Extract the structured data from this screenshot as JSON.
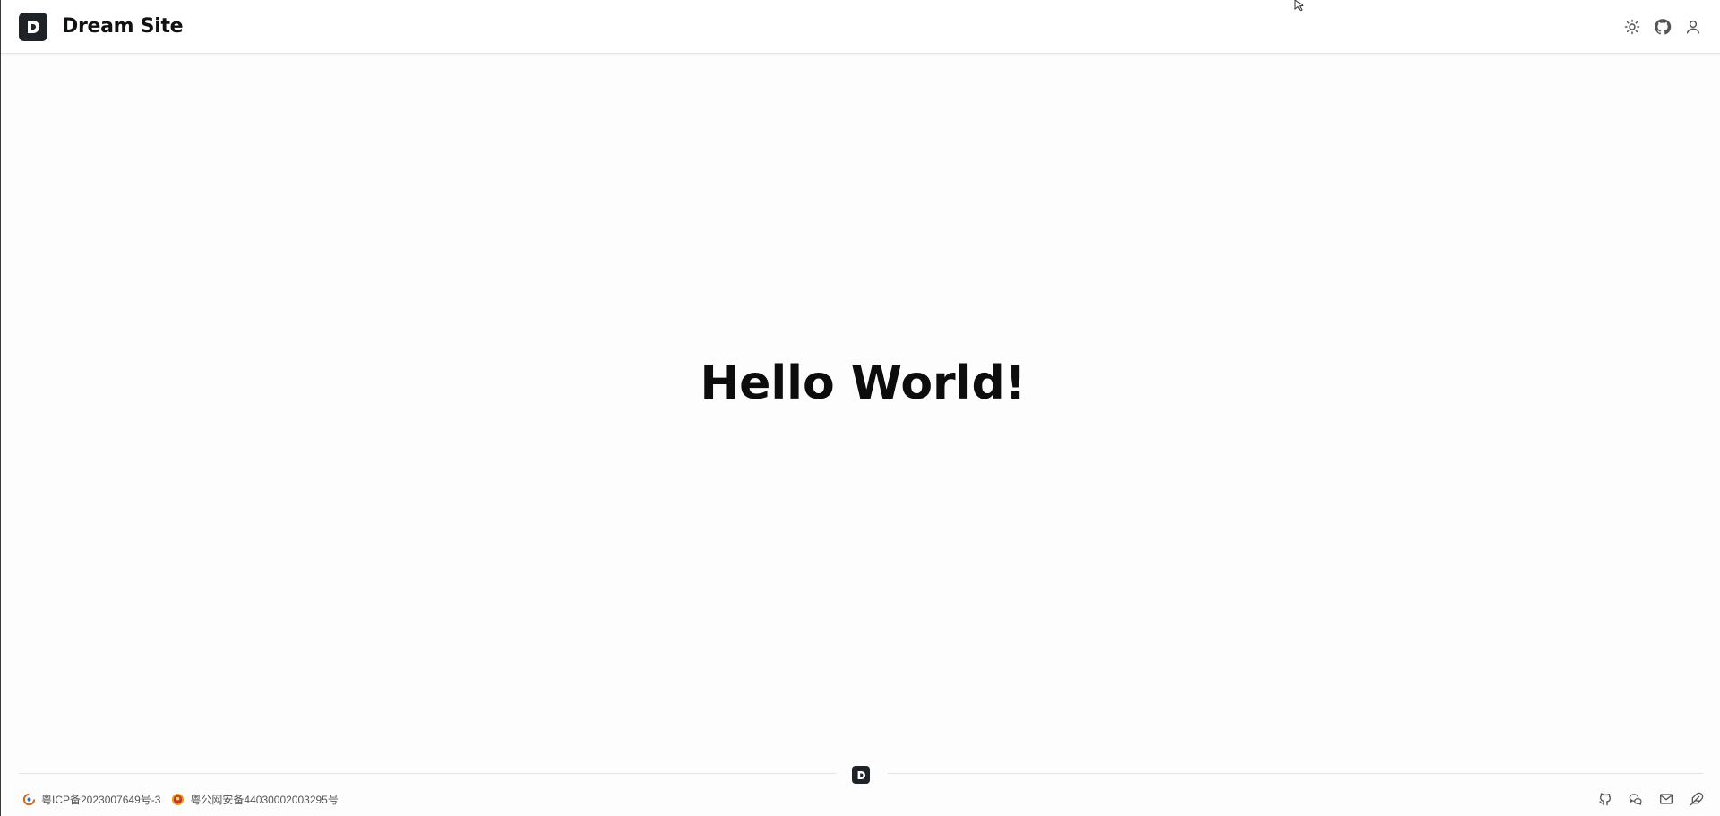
{
  "header": {
    "logo_letter": "D",
    "title": "Dream Site",
    "actions": [
      {
        "icon": "sun-icon"
      },
      {
        "icon": "github-icon"
      },
      {
        "icon": "user-icon"
      }
    ]
  },
  "main": {
    "hero_text": "Hello World!"
  },
  "footer": {
    "logo_letter": "D",
    "icp_record": "粤ICP备2023007649号-3",
    "police_record": "粤公网安备44030002003295号",
    "social": [
      {
        "icon": "github-icon"
      },
      {
        "icon": "wechat-icon"
      },
      {
        "icon": "mail-icon"
      },
      {
        "icon": "feather-icon"
      }
    ]
  },
  "colors": {
    "logo_bg": "#1f2328",
    "text": "#0d0d0d",
    "muted": "#555555"
  }
}
